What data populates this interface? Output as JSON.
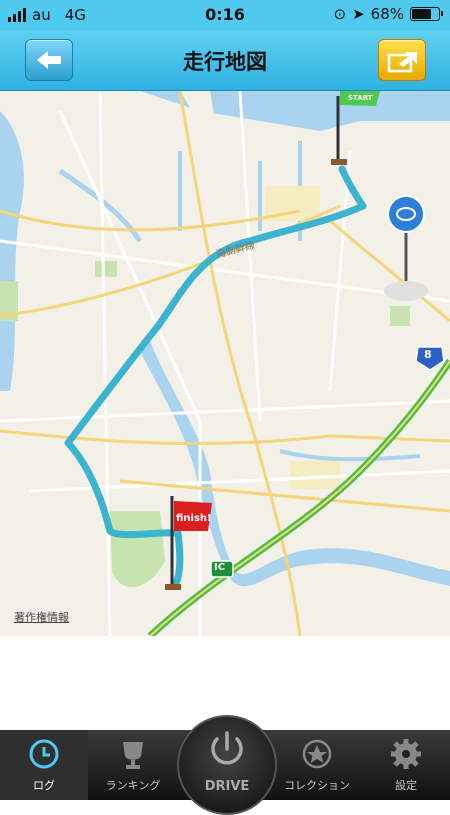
{
  "status": {
    "carrier": "au",
    "network": "4G",
    "time": "0:16",
    "battery": "68%"
  },
  "nav": {
    "title": "走行地図",
    "back_icon": "back-arrow-icon",
    "share_icon": "share-arrow-icon"
  },
  "map": {
    "start_flag": "START",
    "finish_flag": "finish!",
    "road_label": "海側幹線",
    "route_badge": "8",
    "ic_badge": "IC",
    "credit": "著作権情報"
  },
  "tabs": [
    {
      "label": "ログ",
      "icon": "clock-icon",
      "active": true
    },
    {
      "label": "ランキング",
      "icon": "trophy-icon",
      "active": false
    },
    {
      "label": "DRIVE",
      "icon": "power-icon",
      "active": false
    },
    {
      "label": "コレクション",
      "icon": "star-icon",
      "active": false
    },
    {
      "label": "設定",
      "icon": "gear-icon",
      "active": false
    }
  ],
  "colors": {
    "accent": "#2fb2e2",
    "route": "#3ab4cf",
    "tab_active": "#4fc9ee"
  }
}
